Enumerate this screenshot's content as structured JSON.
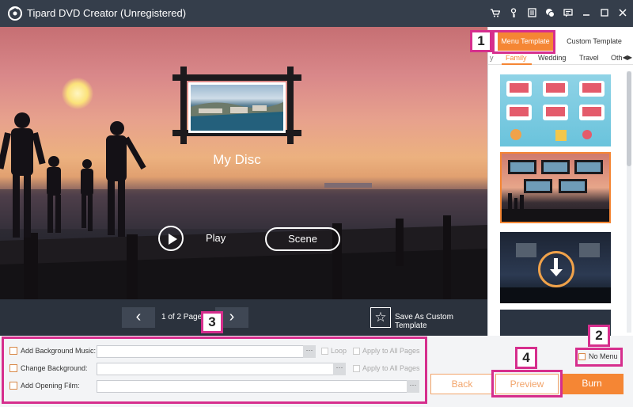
{
  "window": {
    "title": "Tipard DVD Creator (Unregistered)",
    "icons": [
      "cart-icon",
      "key-icon",
      "register-icon",
      "chat-icon",
      "feedback-icon",
      "minimize-icon",
      "maximize-icon",
      "close-icon"
    ]
  },
  "preview": {
    "disc_title": "My Disc",
    "play_label": "Play",
    "scene_label": "Scene"
  },
  "pagenav": {
    "prev_symbol": "‹",
    "next_symbol": "›",
    "page_info": "1 of 2 Pages",
    "save_as_template": "Save As Custom Template"
  },
  "template_panel": {
    "tabs": [
      "Menu Template",
      "Custom Template"
    ],
    "categories": {
      "prefix": "y",
      "items": [
        "Family",
        "Wedding",
        "Travel",
        "Oth"
      ],
      "selected": "Family"
    },
    "selected_template_index": 1
  },
  "options": {
    "background_music": {
      "label": "Add Background Music:",
      "value": "",
      "loop": "Loop",
      "apply_all": "Apply to All Pages"
    },
    "change_background": {
      "label": "Change Background:",
      "value": "",
      "apply_all": "Apply to All Pages"
    },
    "opening_film": {
      "label": "Add Opening Film:",
      "value": ""
    },
    "browse_label": "···"
  },
  "no_menu_label": "No Menu",
  "buttons": {
    "back": "Back",
    "preview": "Preview",
    "burn": "Burn"
  },
  "annotations": [
    "1",
    "2",
    "3",
    "4"
  ],
  "colors": {
    "accent": "#f58634",
    "annotation": "#d62e8d",
    "titlebar": "#353e4b"
  }
}
